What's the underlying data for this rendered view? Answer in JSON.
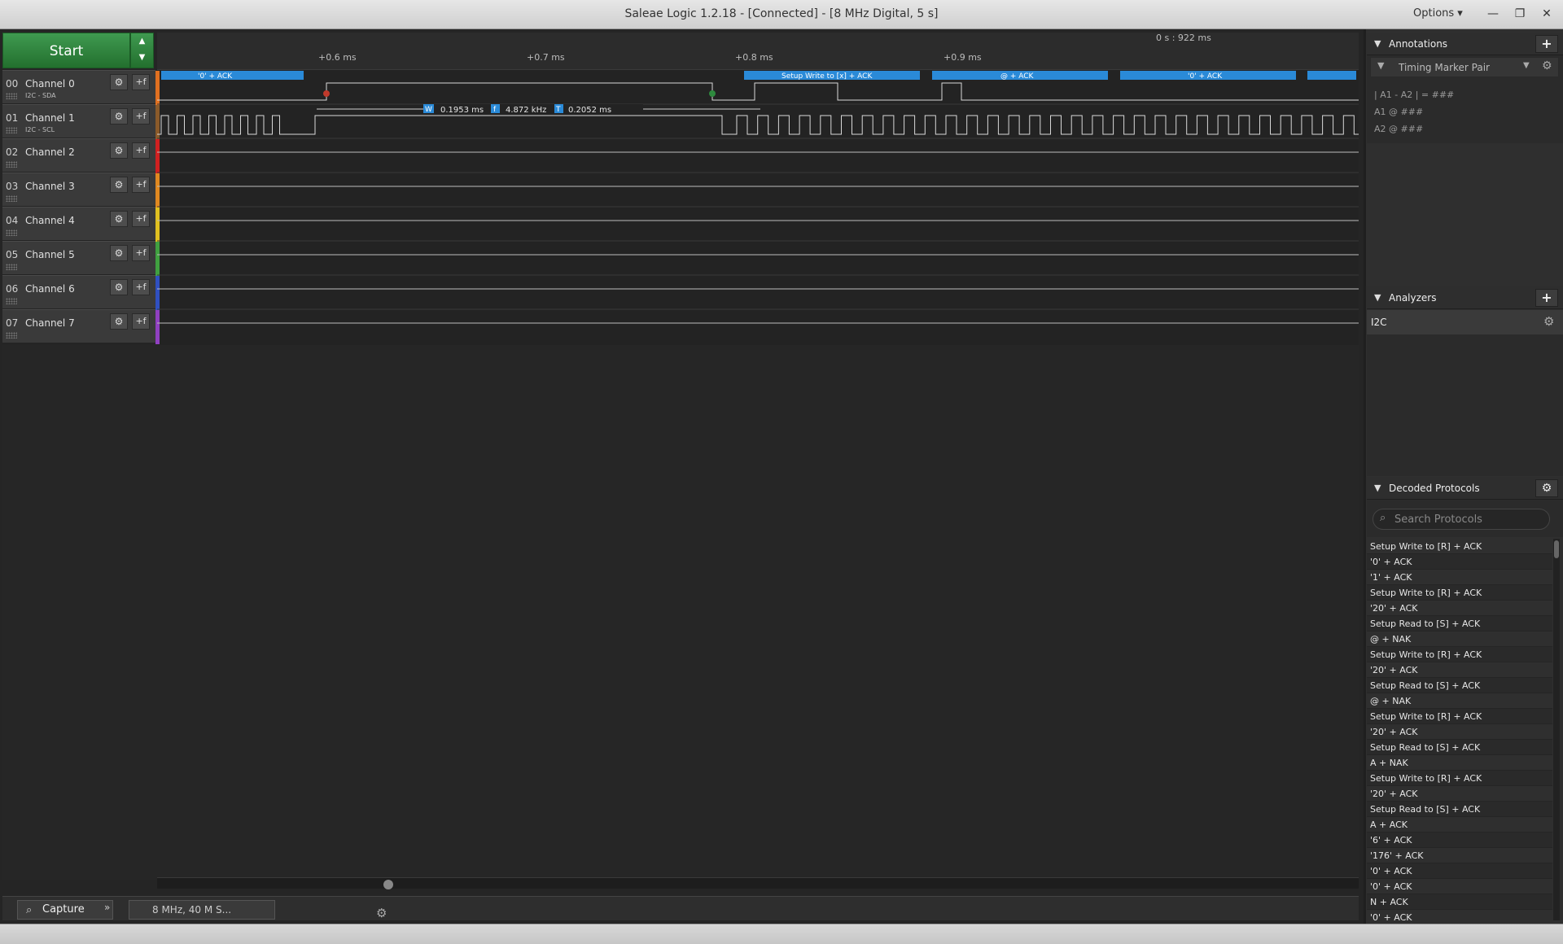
{
  "window": {
    "title": "Saleae Logic 1.2.18 - [Connected] - [8 MHz Digital, 5 s]",
    "options_label": "Options ▾",
    "minimize": "—",
    "restore": "❐",
    "close": "✕"
  },
  "start_button": {
    "label": "Start",
    "up": "▲",
    "down": "▼"
  },
  "channels": [
    {
      "num": "00",
      "name": "Channel 0",
      "sub": "I2C - SDA",
      "color": "#e07020"
    },
    {
      "num": "01",
      "name": "Channel 1",
      "sub": "I2C - SCL",
      "color": "#8a5a2a"
    },
    {
      "num": "02",
      "name": "Channel 2",
      "sub": "",
      "color": "#d02020"
    },
    {
      "num": "03",
      "name": "Channel 3",
      "sub": "",
      "color": "#e08820"
    },
    {
      "num": "04",
      "name": "Channel 4",
      "sub": "",
      "color": "#e0c020"
    },
    {
      "num": "05",
      "name": "Channel 5",
      "sub": "",
      "color": "#40a040"
    },
    {
      "num": "06",
      "name": "Channel 6",
      "sub": "",
      "color": "#3050c0"
    },
    {
      "num": "07",
      "name": "Channel 7",
      "sub": "",
      "color": "#9040c0"
    }
  ],
  "channel_buttons": {
    "gear": "⚙",
    "trigger": "+f"
  },
  "ruler": {
    "ticks": [
      "+0.6 ms",
      "+0.7 ms",
      "+0.8 ms",
      "+0.9 ms"
    ],
    "readout": "0 s : 922 ms"
  },
  "decode_bubbles": [
    "'0' + ACK",
    "Setup Write to [x] + ACK",
    "@ + ACK",
    "'0' + ACK"
  ],
  "measurement": {
    "width_icon": "W",
    "width": "0.1953 ms",
    "freq_icon": "f",
    "freq": "4.872 kHz",
    "period_icon": "T",
    "period": "0.2052 ms"
  },
  "bottom": {
    "capture_label": "Capture",
    "expand": "»",
    "session_label": "8 MHz, 40 M S...",
    "gear": "⚙"
  },
  "annotations": {
    "title": "Annotations",
    "add": "+",
    "marker_pair": "Timing Marker Pair",
    "line1": "| A1 - A2 | = ###",
    "a1": "A1",
    "a2": "A2",
    "a1_value": "@  ###",
    "a2_value": "@  ###"
  },
  "analyzers": {
    "title": "Analyzers",
    "add": "+",
    "items": [
      "I2C"
    ]
  },
  "decoded_protocols": {
    "title": "Decoded Protocols",
    "search_placeholder": "Search Protocols",
    "items": [
      "Setup Write to [R] + ACK",
      "'0' + ACK",
      "'1' + ACK",
      "Setup Write to [R] + ACK",
      "'20' + ACK",
      "Setup Read to [S] + ACK",
      "@ + NAK",
      "Setup Write to [R] + ACK",
      "'20' + ACK",
      "Setup Read to [S] + ACK",
      "@ + NAK",
      "Setup Write to [R] + ACK",
      "'20' + ACK",
      "Setup Read to [S] + ACK",
      "A + NAK",
      "Setup Write to [R] + ACK",
      "'20' + ACK",
      "Setup Read to [S] + ACK",
      "A + ACK",
      "'6' + ACK",
      "'176' + ACK",
      "'0' + ACK",
      "'0' + ACK",
      "N + ACK",
      "'0' + ACK"
    ]
  },
  "colors": {
    "bubble": "#2a8ad8",
    "accent_green": "#2e8a3e"
  }
}
